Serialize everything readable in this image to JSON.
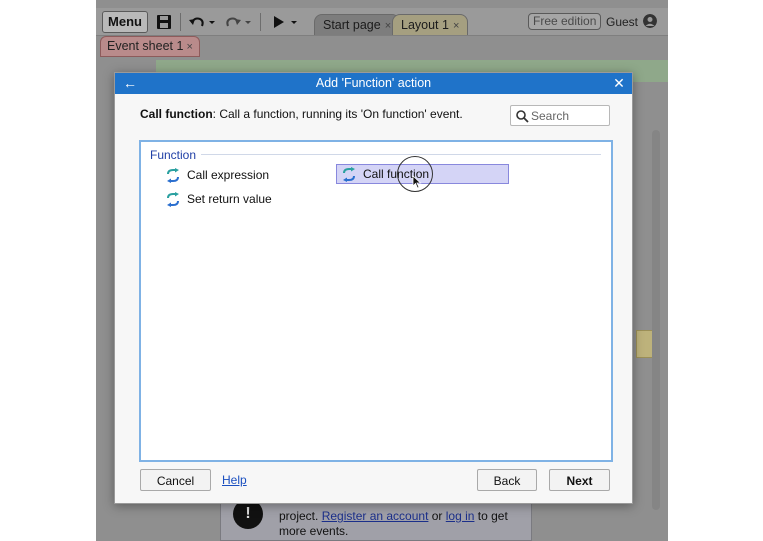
{
  "app": {
    "menu_label": "Menu",
    "tabs": [
      {
        "label": "Start page",
        "close": "×"
      },
      {
        "label": "Layout 1",
        "close": "×"
      }
    ],
    "edition_badge": "Free edition",
    "user_label": "Guest",
    "event_sheet_tab": {
      "label": "Event sheet 1",
      "close": "×"
    }
  },
  "info_panel": {
    "icon_text": "!",
    "text_before": "project. ",
    "link1": "Register an account",
    "text_mid": " or ",
    "link2": "log in",
    "text_after": " to get more events."
  },
  "dialog": {
    "title": "Add 'Function' action",
    "back_glyph": "←",
    "close_glyph": "✕",
    "description_bold": "Call function",
    "description_rest": ": Call a function, running its 'On function' event.",
    "search_placeholder": "Search",
    "category": "Function",
    "actions": [
      {
        "label": "Call expression"
      },
      {
        "label": "Call function",
        "selected": true
      },
      {
        "label": "Set return value"
      }
    ],
    "cancel_label": "Cancel",
    "help_label": "Help",
    "back_label": "Back",
    "next_label": "Next"
  },
  "colors": {
    "title_bar": "#1f73c9",
    "selection": "#d4d4f6",
    "list_border": "#7fb2e5",
    "category_text": "#1f3fa6"
  }
}
